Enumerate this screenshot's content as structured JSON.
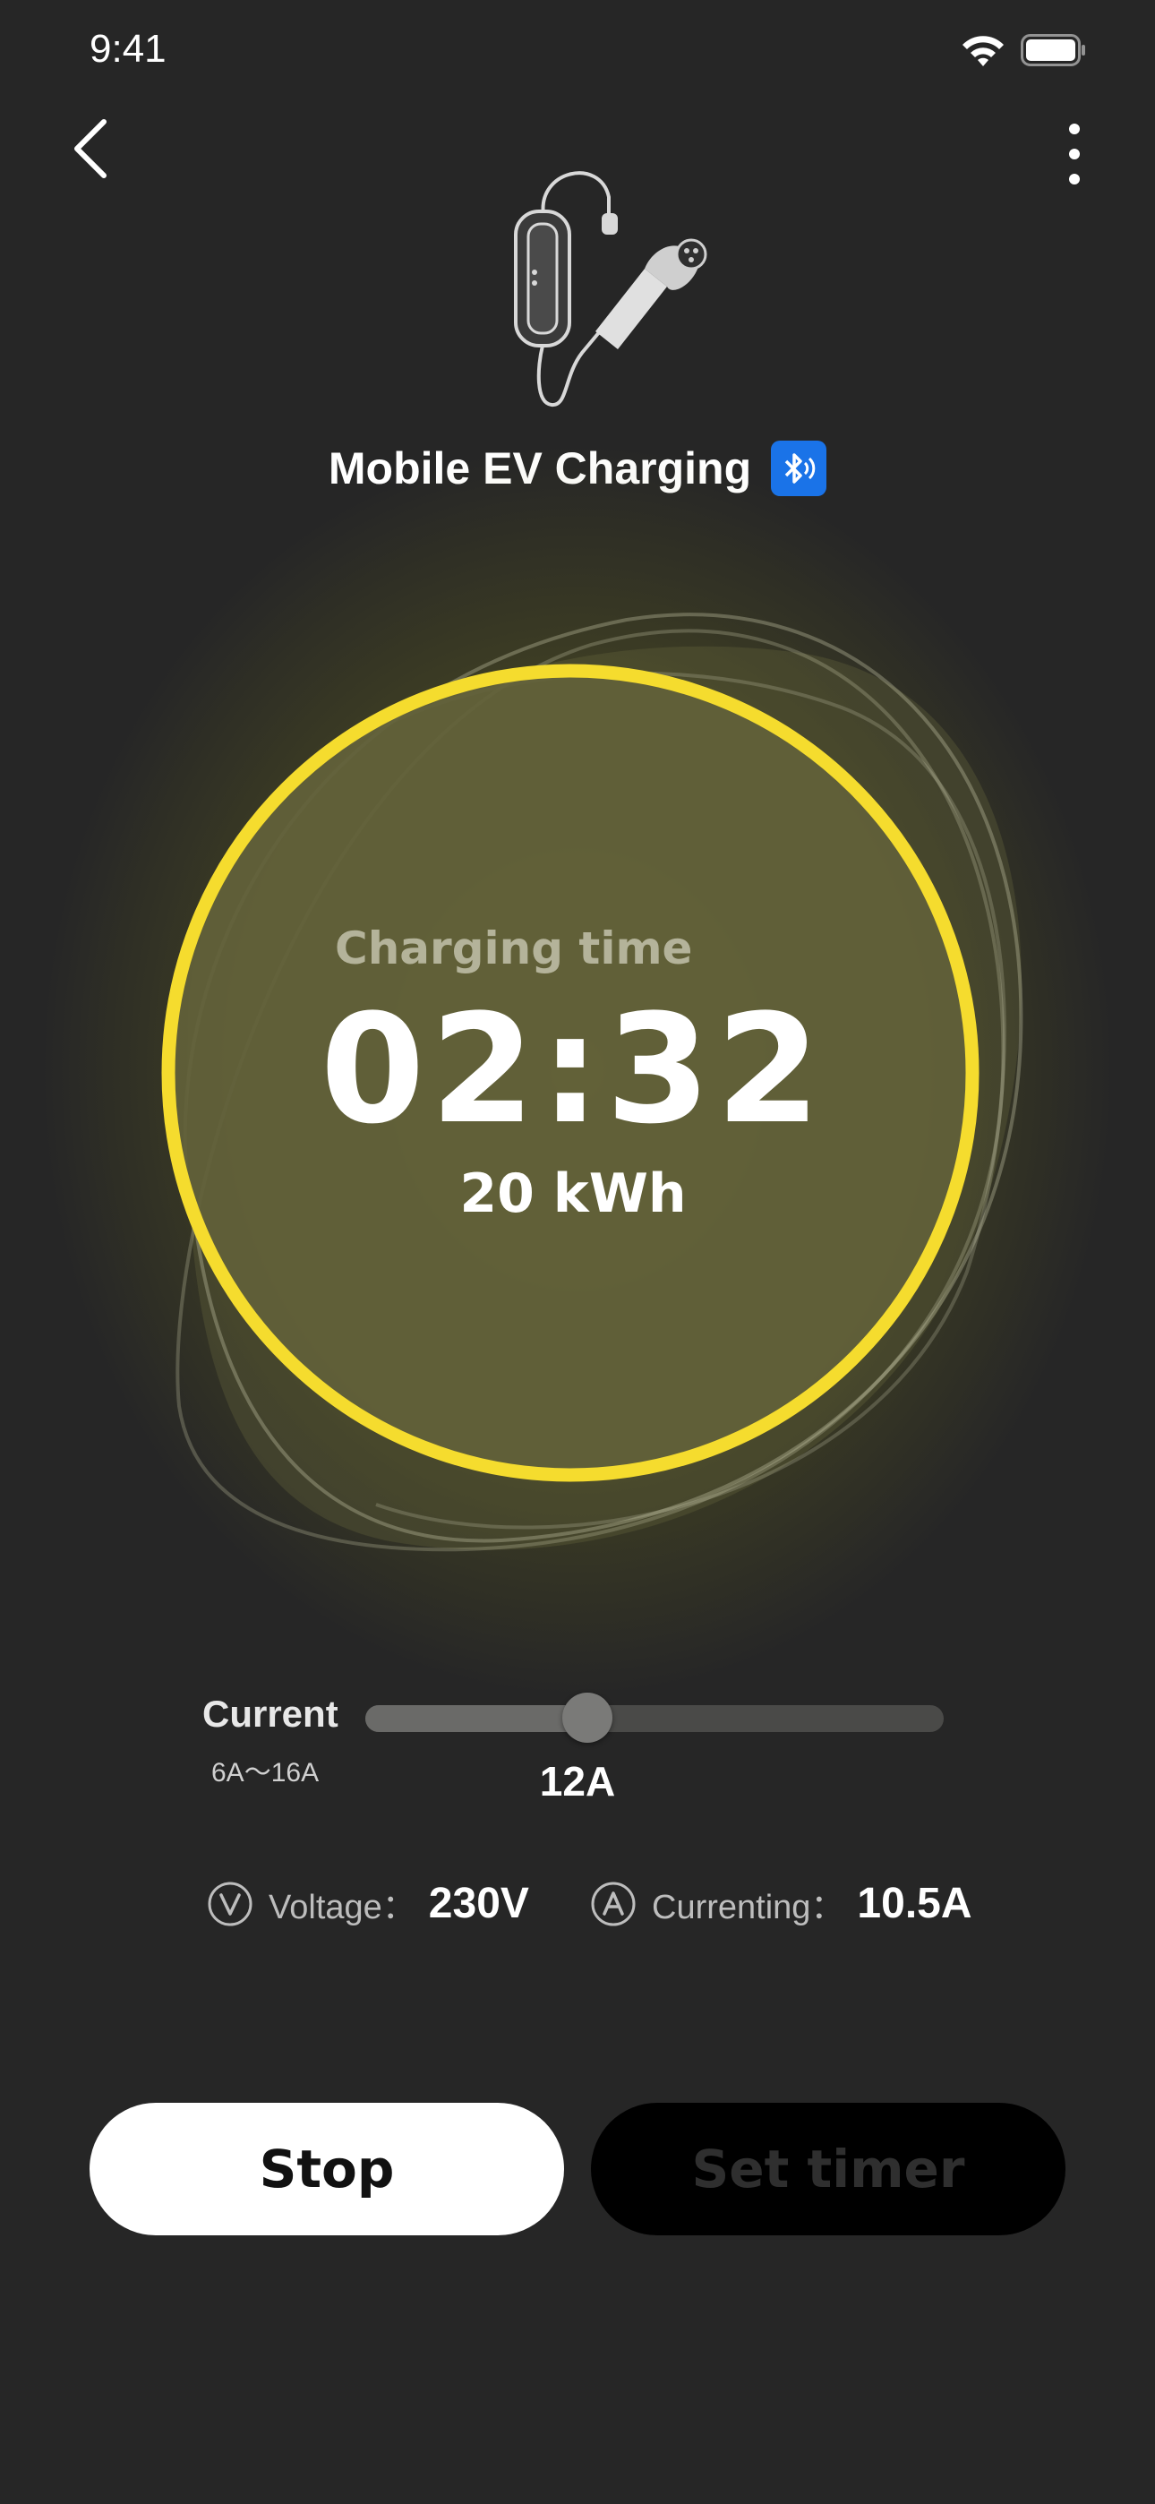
{
  "status_bar": {
    "time": "9:41",
    "icons": [
      "wifi-icon",
      "battery-icon"
    ]
  },
  "header": {
    "back_icon": "chevron-left-icon",
    "menu_icon": "more-vertical-icon",
    "device_image": "ev-charger-image",
    "device_name": "Mobile EV Charging",
    "connection_icon": "bluetooth-icon"
  },
  "charging": {
    "label": "Charging time",
    "time": "02:32",
    "energy": "20 kWh"
  },
  "current": {
    "label": "Current",
    "range": "6A～16A",
    "value": "12A",
    "min": 6,
    "max": 16,
    "setting": 12
  },
  "readings": {
    "voltage_label": "Voltage：",
    "voltage_value": "230V",
    "currenting_label": "Currenting：",
    "currenting_value": "10.5A"
  },
  "actions": {
    "stop_label": "Stop",
    "timer_label": "Set timer"
  },
  "colors": {
    "background": "#262626",
    "accent": "#f5dc2e",
    "bluetooth": "#1a73e8"
  }
}
